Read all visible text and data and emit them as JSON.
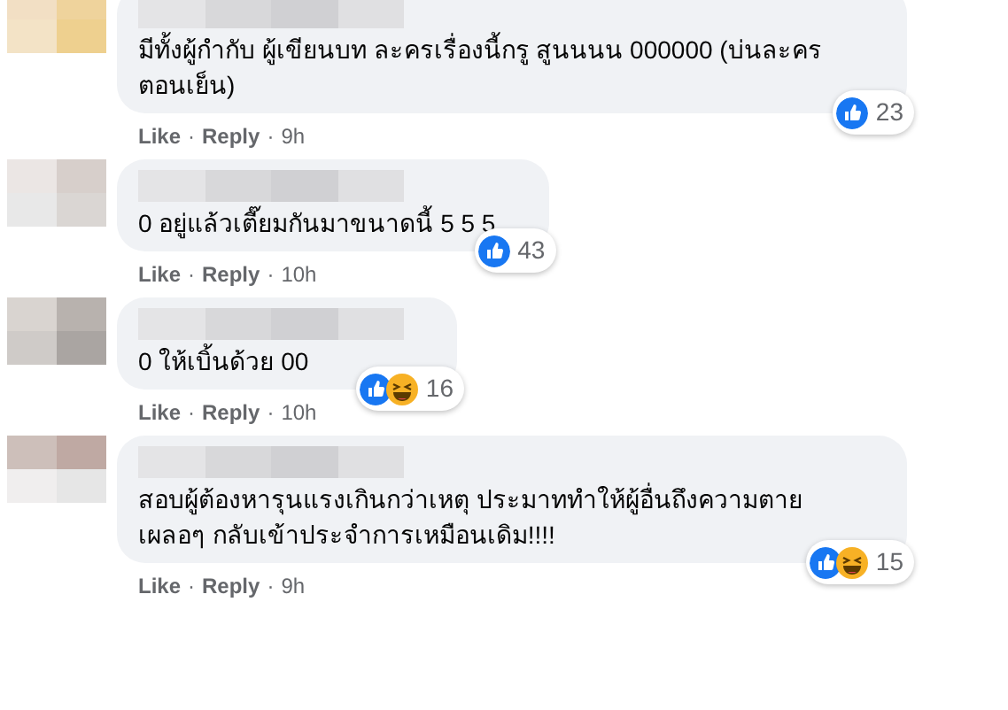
{
  "comments": [
    {
      "text": "มีทั้งผู้กำกับ ผู้เขียนบท ละครเรื่องนี้กรู สูนนนน 000000 (บ่นละครตอนเย็น)",
      "reactions": [
        {
          "kind": "like"
        }
      ],
      "count": "23",
      "footer": [
        {
          "kind": "link",
          "text": "Like"
        },
        {
          "kind": "dot",
          "text": "·"
        },
        {
          "kind": "link",
          "text": "Reply"
        },
        {
          "kind": "dot",
          "text": "·"
        },
        {
          "kind": "time",
          "text": "9h"
        }
      ]
    },
    {
      "text": "0 อยู่แล้วเตี๊ยมกันมาขนาดนี้ 5 5 5",
      "reactions": [
        {
          "kind": "like"
        }
      ],
      "count": "43",
      "footer": [
        {
          "kind": "link",
          "text": "Like"
        },
        {
          "kind": "dot",
          "text": "·"
        },
        {
          "kind": "link",
          "text": "Reply"
        },
        {
          "kind": "dot",
          "text": "·"
        },
        {
          "kind": "time",
          "text": "10h"
        }
      ]
    },
    {
      "text": "0 ให้เบิ้นด้วย 00",
      "reactions": [
        {
          "kind": "like"
        },
        {
          "kind": "haha"
        }
      ],
      "count": "16",
      "footer": [
        {
          "kind": "link",
          "text": "Like"
        },
        {
          "kind": "dot",
          "text": "·"
        },
        {
          "kind": "link",
          "text": "Reply"
        },
        {
          "kind": "dot",
          "text": "·"
        },
        {
          "kind": "time",
          "text": "10h"
        }
      ]
    },
    {
      "text": "สอบผู้ต้องหารุนแรงเกินกว่าเหตุ ประมาททำให้ผู้อื่นถึงความตาย เผลอๆ กลับเข้าประจำการเหมือนเดิม!!!!",
      "reactions": [
        {
          "kind": "like"
        },
        {
          "kind": "haha"
        }
      ],
      "count": "15",
      "footer": [
        {
          "kind": "link",
          "text": "Like"
        },
        {
          "kind": "dot",
          "text": "·"
        },
        {
          "kind": "link",
          "text": "Reply"
        },
        {
          "kind": "dot",
          "text": "·"
        },
        {
          "kind": "time",
          "text": "9h"
        }
      ]
    }
  ]
}
